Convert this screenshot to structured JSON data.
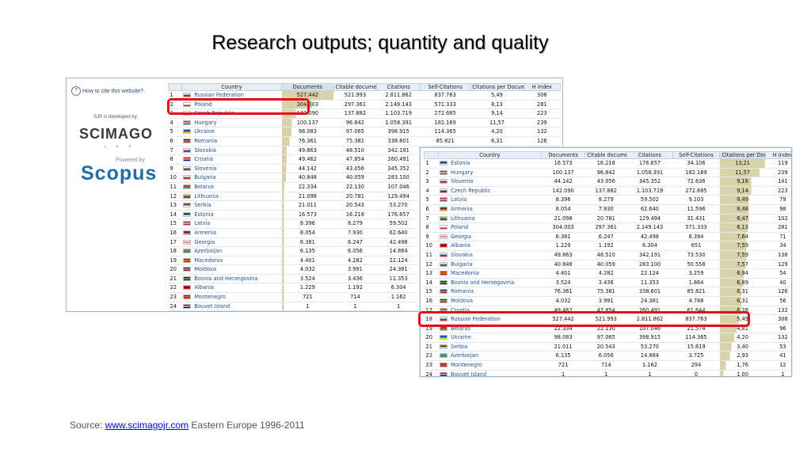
{
  "title": "Research outputs; quantity and quality",
  "sidebar": {
    "cite_link": "How to cite this website?",
    "developed_by": "SJR is developed by:",
    "scimago": "SCIMAGO",
    "scimago_lab": "L A B",
    "powered_by": "Powered by",
    "scopus": "Scopus"
  },
  "table1": {
    "headers": [
      "Country",
      "Documents",
      "Citable documents",
      "Citations",
      "Self-Citations",
      "Citations per Document",
      "H index"
    ],
    "rows": [
      [
        "1",
        "Russian Federation",
        "527.442",
        "521.993",
        "2.811.862",
        "837.763",
        "5,49",
        "308"
      ],
      [
        "2",
        "Poland",
        "304.003",
        "297.361",
        "2.149.143",
        "571.333",
        "8,13",
        "281"
      ],
      [
        "3",
        "Czech Republic",
        "142.090",
        "137.882",
        "1.103.719",
        "272.685",
        "9,14",
        "223"
      ],
      [
        "4",
        "Hungary",
        "100.137",
        "96.842",
        "1.058.391",
        "182.169",
        "11,57",
        "239"
      ],
      [
        "5",
        "Ukraine",
        "98.083",
        "97.065",
        "398.915",
        "114.365",
        "4,20",
        "132"
      ],
      [
        "6",
        "Romania",
        "76.361",
        "75.381",
        "338.601",
        "85.821",
        "6,31",
        "126"
      ],
      [
        "7",
        "Slovakia",
        "49.863",
        "48.510",
        "342.191",
        "",
        "",
        ""
      ],
      [
        "8",
        "Croatia",
        "49.462",
        "47.854",
        "260.491",
        "",
        "",
        ""
      ],
      [
        "9",
        "Slovenia",
        "44.142",
        "43.056",
        "345.352",
        "",
        "",
        ""
      ],
      [
        "10",
        "Bulgaria",
        "40.848",
        "40.059",
        "283.100",
        "",
        "",
        ""
      ],
      [
        "11",
        "Belarus",
        "22.334",
        "22.130",
        "107.046",
        "",
        "",
        ""
      ],
      [
        "12",
        "Lithuania",
        "21.098",
        "20.781",
        "129.494",
        "",
        "",
        ""
      ],
      [
        "13",
        "Serbia",
        "21.011",
        "20.543",
        "53.270",
        "",
        "",
        ""
      ],
      [
        "14",
        "Estonia",
        "16.573",
        "16.218",
        "176.657",
        "",
        "",
        ""
      ],
      [
        "15",
        "Latvia",
        "8.396",
        "8.279",
        "59.502",
        "",
        "",
        ""
      ],
      [
        "16",
        "Armenia",
        "8.054",
        "7.930",
        "62.640",
        "",
        "",
        ""
      ],
      [
        "17",
        "Georgia",
        "6.381",
        "6.247",
        "42.498",
        "",
        "",
        ""
      ],
      [
        "18",
        "Azerbaijan",
        "6.135",
        "6.056",
        "14.884",
        "",
        "",
        ""
      ],
      [
        "19",
        "Macedonia",
        "4.401",
        "4.282",
        "22.124",
        "",
        "",
        ""
      ],
      [
        "20",
        "Moldova",
        "4.032",
        "3.991",
        "24.381",
        "",
        "",
        ""
      ],
      [
        "21",
        "Bosnia and Herzegovina",
        "3.524",
        "3.436",
        "11.353",
        "",
        "",
        ""
      ],
      [
        "22",
        "Albania",
        "1.229",
        "1.192",
        "6.304",
        "",
        "",
        ""
      ],
      [
        "23",
        "Montenegro",
        "721",
        "714",
        "1.162",
        "",
        "",
        ""
      ],
      [
        "24",
        "Bouvet Island",
        "1",
        "1",
        "1",
        "",
        "",
        ""
      ]
    ]
  },
  "table2": {
    "headers": [
      "Country",
      "Documents",
      "Citable documents",
      "Citations",
      "Self-Citations",
      "Citations per Document",
      "H Index"
    ],
    "rows": [
      [
        "1",
        "Estonia",
        "16.573",
        "16.218",
        "176.657",
        "34.106",
        "13,21",
        "119"
      ],
      [
        "2",
        "Hungary",
        "100.137",
        "96.842",
        "1.058.391",
        "182.169",
        "11,57",
        "239"
      ],
      [
        "3",
        "Slovenia",
        "44.142",
        "43.056",
        "345.352",
        "72.636",
        "9,16",
        "141"
      ],
      [
        "4",
        "Czech Republic",
        "142.090",
        "137.882",
        "1.103.719",
        "272.685",
        "9,14",
        "223"
      ],
      [
        "5",
        "Latvia",
        "8.396",
        "8.279",
        "59.502",
        "9.103",
        "8,49",
        "79"
      ],
      [
        "6",
        "Armenia",
        "8.054",
        "7.930",
        "62.640",
        "11.596",
        "8,48",
        "98"
      ],
      [
        "7",
        "Lithuania",
        "21.098",
        "20.781",
        "129.494",
        "31.431",
        "8,47",
        "102"
      ],
      [
        "8",
        "Poland",
        "304.003",
        "297.361",
        "2.149.143",
        "571.333",
        "8,13",
        "281"
      ],
      [
        "9",
        "Georgia",
        "6.381",
        "6.247",
        "42.498",
        "6.394",
        "7,64",
        "71"
      ],
      [
        "10",
        "Albania",
        "1.229",
        "1.192",
        "6.304",
        "651",
        "7,59",
        "34"
      ],
      [
        "11",
        "Slovakia",
        "49.863",
        "48.510",
        "342.191",
        "73.530",
        "7,59",
        "138"
      ],
      [
        "12",
        "Bulgaria",
        "40.848",
        "40.059",
        "283.100",
        "50.558",
        "7,57",
        "129"
      ],
      [
        "13",
        "Macedonia",
        "4.401",
        "4.282",
        "22.124",
        "3.259",
        "6,94",
        "54"
      ],
      [
        "14",
        "Bosnia and Herzegovina",
        "3.524",
        "3.436",
        "11.353",
        "1.864",
        "6,89",
        "40"
      ],
      [
        "15",
        "Romania",
        "76.361",
        "75.381",
        "338.601",
        "85.821",
        "6,31",
        "126"
      ],
      [
        "16",
        "Moldova",
        "4.032",
        "3.991",
        "24.381",
        "4.788",
        "6,31",
        "56"
      ],
      [
        "17",
        "Croatia",
        "49.462",
        "47.854",
        "260.491",
        "61.644",
        "6,26",
        "132"
      ],
      [
        "18",
        "Russian Federation",
        "527.442",
        "521.993",
        "2.811.862",
        "837.763",
        "5,49",
        "308"
      ],
      [
        "19",
        "Belarus",
        "22.334",
        "22.130",
        "107.046",
        "21.574",
        "4,81",
        "96"
      ],
      [
        "20",
        "Ukraine",
        "98.083",
        "97.065",
        "398.915",
        "114.365",
        "4,20",
        "132"
      ],
      [
        "21",
        "Serbia",
        "21.011",
        "20.543",
        "53.270",
        "15.819",
        "3,40",
        "53"
      ],
      [
        "22",
        "Azerbaijan",
        "6.135",
        "6.056",
        "14.884",
        "3.725",
        "2,93",
        "41"
      ],
      [
        "23",
        "Montenegro",
        "721",
        "714",
        "1.162",
        "294",
        "1,76",
        "12"
      ],
      [
        "24",
        "Bouvet Island",
        "1",
        "1",
        "1",
        "0",
        "1,00",
        "1"
      ]
    ]
  },
  "source": {
    "prefix": "Source: ",
    "link": "www.scimagojr.com",
    "suffix": " Eastern Europe 1996-2011"
  },
  "colors": {
    "highlight_box": "#e3101a",
    "bar_fill": "#d8d2a8",
    "link": "#1d4f91"
  }
}
